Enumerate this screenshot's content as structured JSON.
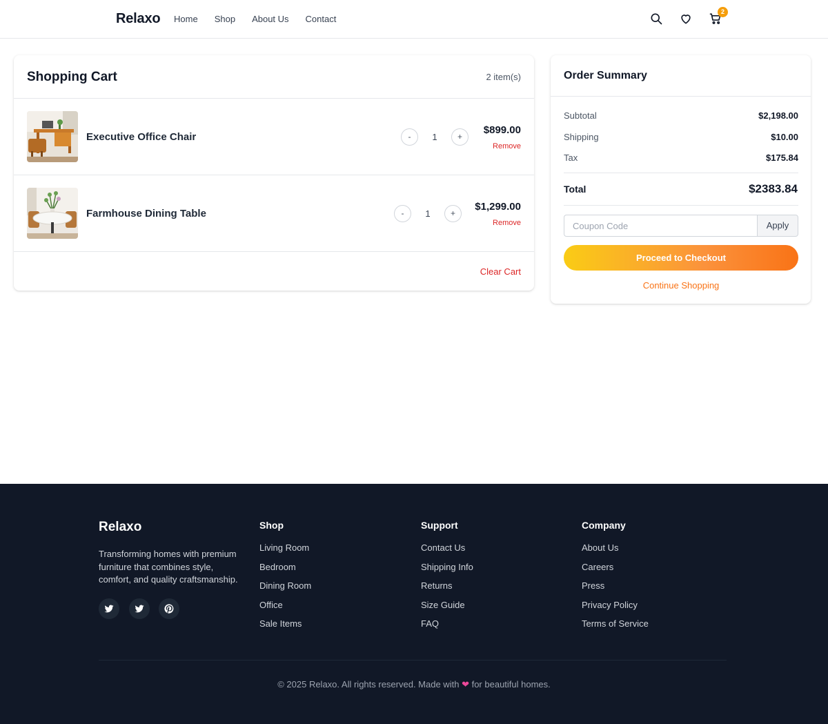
{
  "header": {
    "logo": "Relaxo",
    "nav": [
      "Home",
      "Shop",
      "About Us",
      "Contact"
    ],
    "cart_count": "2",
    "icons": [
      "search-icon",
      "heart-icon",
      "cart-icon"
    ]
  },
  "cart": {
    "title": "Shopping Cart",
    "count_label": "2 item(s)",
    "items": [
      {
        "name": "Executive Office Chair",
        "quantity": "1",
        "price": "$899.00",
        "remove_label": "Remove",
        "decrement": "-",
        "increment": "+"
      },
      {
        "name": "Farmhouse Dining Table",
        "quantity": "1",
        "price": "$1,299.00",
        "remove_label": "Remove",
        "decrement": "-",
        "increment": "+"
      }
    ],
    "clear_label": "Clear Cart"
  },
  "summary": {
    "title": "Order Summary",
    "lines": [
      {
        "label": "Subtotal",
        "value": "$2,198.00"
      },
      {
        "label": "Shipping",
        "value": "$10.00"
      },
      {
        "label": "Tax",
        "value": "$175.84"
      }
    ],
    "total_label": "Total",
    "total_value": "$2383.84",
    "coupon_placeholder": "Coupon Code",
    "apply_label": "Apply",
    "checkout_label": "Proceed to Checkout",
    "continue_label": "Continue Shopping"
  },
  "footer": {
    "brand": "Relaxo",
    "description": "Transforming homes with premium furniture that combines style, comfort, and quality craftsmanship.",
    "social": [
      "twitter-icon",
      "twitter-icon",
      "pinterest-icon"
    ],
    "columns": [
      {
        "title": "Shop",
        "links": [
          "Living Room",
          "Bedroom",
          "Dining Room",
          "Office",
          "Sale Items"
        ]
      },
      {
        "title": "Support",
        "links": [
          "Contact Us",
          "Shipping Info",
          "Returns",
          "Size Guide",
          "FAQ"
        ]
      },
      {
        "title": "Company",
        "links": [
          "About Us",
          "Careers",
          "Press",
          "Privacy Policy",
          "Terms of Service"
        ]
      }
    ],
    "copyright_pre": "© 2025 Relaxo. All rights reserved. Made with",
    "copyright_post": "for beautiful homes."
  },
  "colors": {
    "accent": "#f97316",
    "accent_gradient_start": "#facc15",
    "danger": "#dc2626",
    "badge": "#f59e0b",
    "footer_bg": "#111827"
  }
}
